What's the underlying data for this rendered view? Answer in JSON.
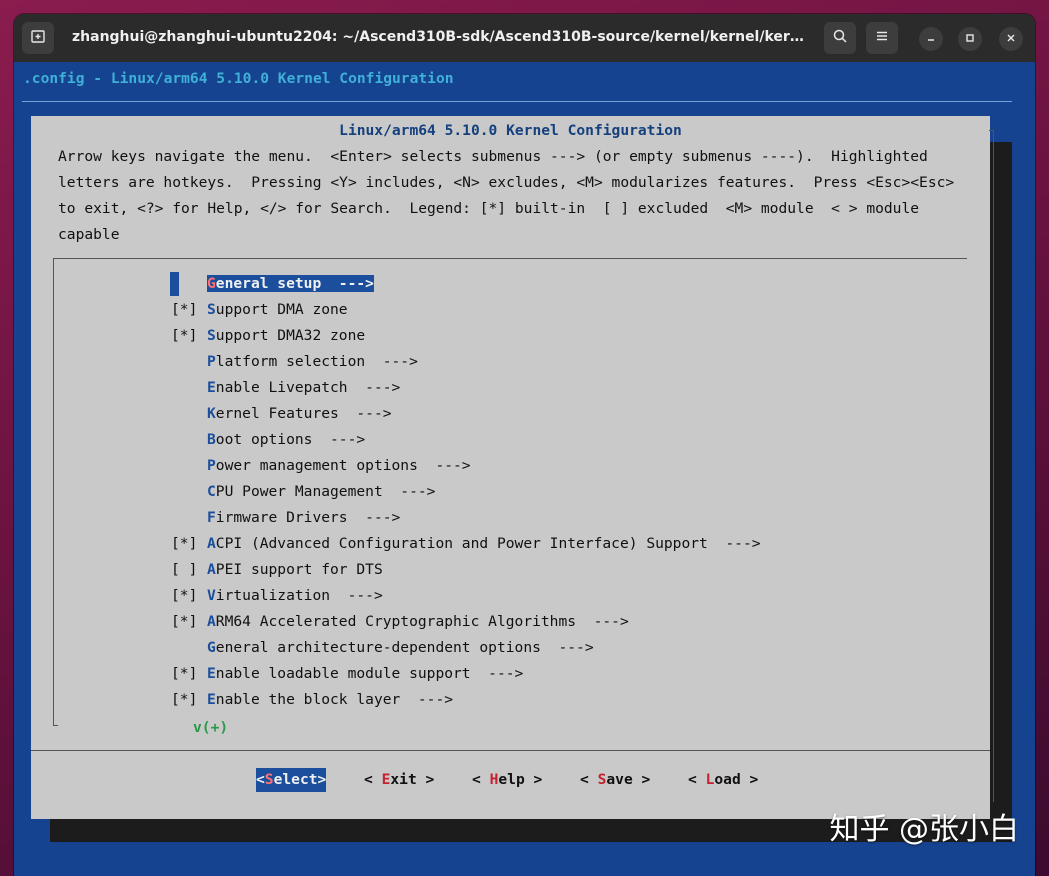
{
  "window": {
    "title": "zhanghui@zhanghui-ubuntu2204: ~/Ascend310B-sdk/Ascend310B-source/kernel/kernel/kernel/out/li..."
  },
  "terminal": {
    "header": ".config - Linux/arm64 5.10.0 Kernel Configuration",
    "dialog_title": "Linux/arm64 5.10.0 Kernel Configuration",
    "help_lines": [
      "Arrow keys navigate the menu.  <Enter> selects submenus ---> (or empty submenus ----).  Highlighted",
      "letters are hotkeys.  Pressing <Y> includes, <N> excludes, <M> modularizes features.  Press <Esc><Esc>",
      "to exit, <?> for Help, </> for Search.  Legend: [*] built-in  [ ] excluded  <M> module  < > module",
      "capable"
    ],
    "menu_items": [
      {
        "mark": "",
        "hotkey": "G",
        "rest": "eneral setup  --->",
        "selected": true
      },
      {
        "mark": "[*]",
        "hotkey": "S",
        "rest": "upport DMA zone"
      },
      {
        "mark": "[*]",
        "hotkey": "S",
        "rest": "upport DMA32 zone"
      },
      {
        "mark": "",
        "hotkey": "P",
        "rest": "latform selection  --->"
      },
      {
        "mark": "",
        "hotkey": "E",
        "rest": "nable Livepatch  --->"
      },
      {
        "mark": "",
        "hotkey": "K",
        "rest": "ernel Features  --->"
      },
      {
        "mark": "",
        "hotkey": "B",
        "rest": "oot options  --->"
      },
      {
        "mark": "",
        "hotkey": "P",
        "rest": "ower management options  --->"
      },
      {
        "mark": "",
        "hotkey": "C",
        "rest": "PU Power Management  --->"
      },
      {
        "mark": "",
        "hotkey": "F",
        "rest": "irmware Drivers  --->"
      },
      {
        "mark": "[*]",
        "hotkey": "A",
        "rest": "CPI (Advanced Configuration and Power Interface) Support  --->"
      },
      {
        "mark": "[ ]",
        "hotkey": "A",
        "rest": "PEI support for DTS"
      },
      {
        "mark": "[*]",
        "hotkey": "V",
        "rest": "irtualization  --->"
      },
      {
        "mark": "[*]",
        "hotkey": "A",
        "rest": "RM64 Accelerated Cryptographic Algorithms  --->"
      },
      {
        "mark": "",
        "hotkey": "G",
        "rest": "eneral architecture-dependent options  --->"
      },
      {
        "mark": "[*]",
        "hotkey": "E",
        "rest": "nable loadable module support  --->"
      },
      {
        "mark": "[*]",
        "hotkey": "E",
        "rest": "nable the block layer  --->"
      }
    ],
    "more_indicator": "v(+)",
    "buttons": [
      {
        "pre": "<",
        "hotkey": "S",
        "rest": "elect>",
        "selected": true
      },
      {
        "pre": "< ",
        "hotkey": "E",
        "rest": "xit >"
      },
      {
        "pre": "< ",
        "hotkey": "H",
        "rest": "elp >"
      },
      {
        "pre": "< ",
        "hotkey": "S",
        "rest": "ave >"
      },
      {
        "pre": "< ",
        "hotkey": "L",
        "rest": "oad >"
      }
    ]
  },
  "watermark": "知乎 @张小白",
  "colors": {
    "terminal_bg": "#16438f",
    "dialog_bg": "#c9c9c9",
    "hotkey": "#1b4e9c",
    "selection": "#1b4e9c",
    "button_hotkey": "#c5222f",
    "more_indicator": "#2a9a4a"
  }
}
